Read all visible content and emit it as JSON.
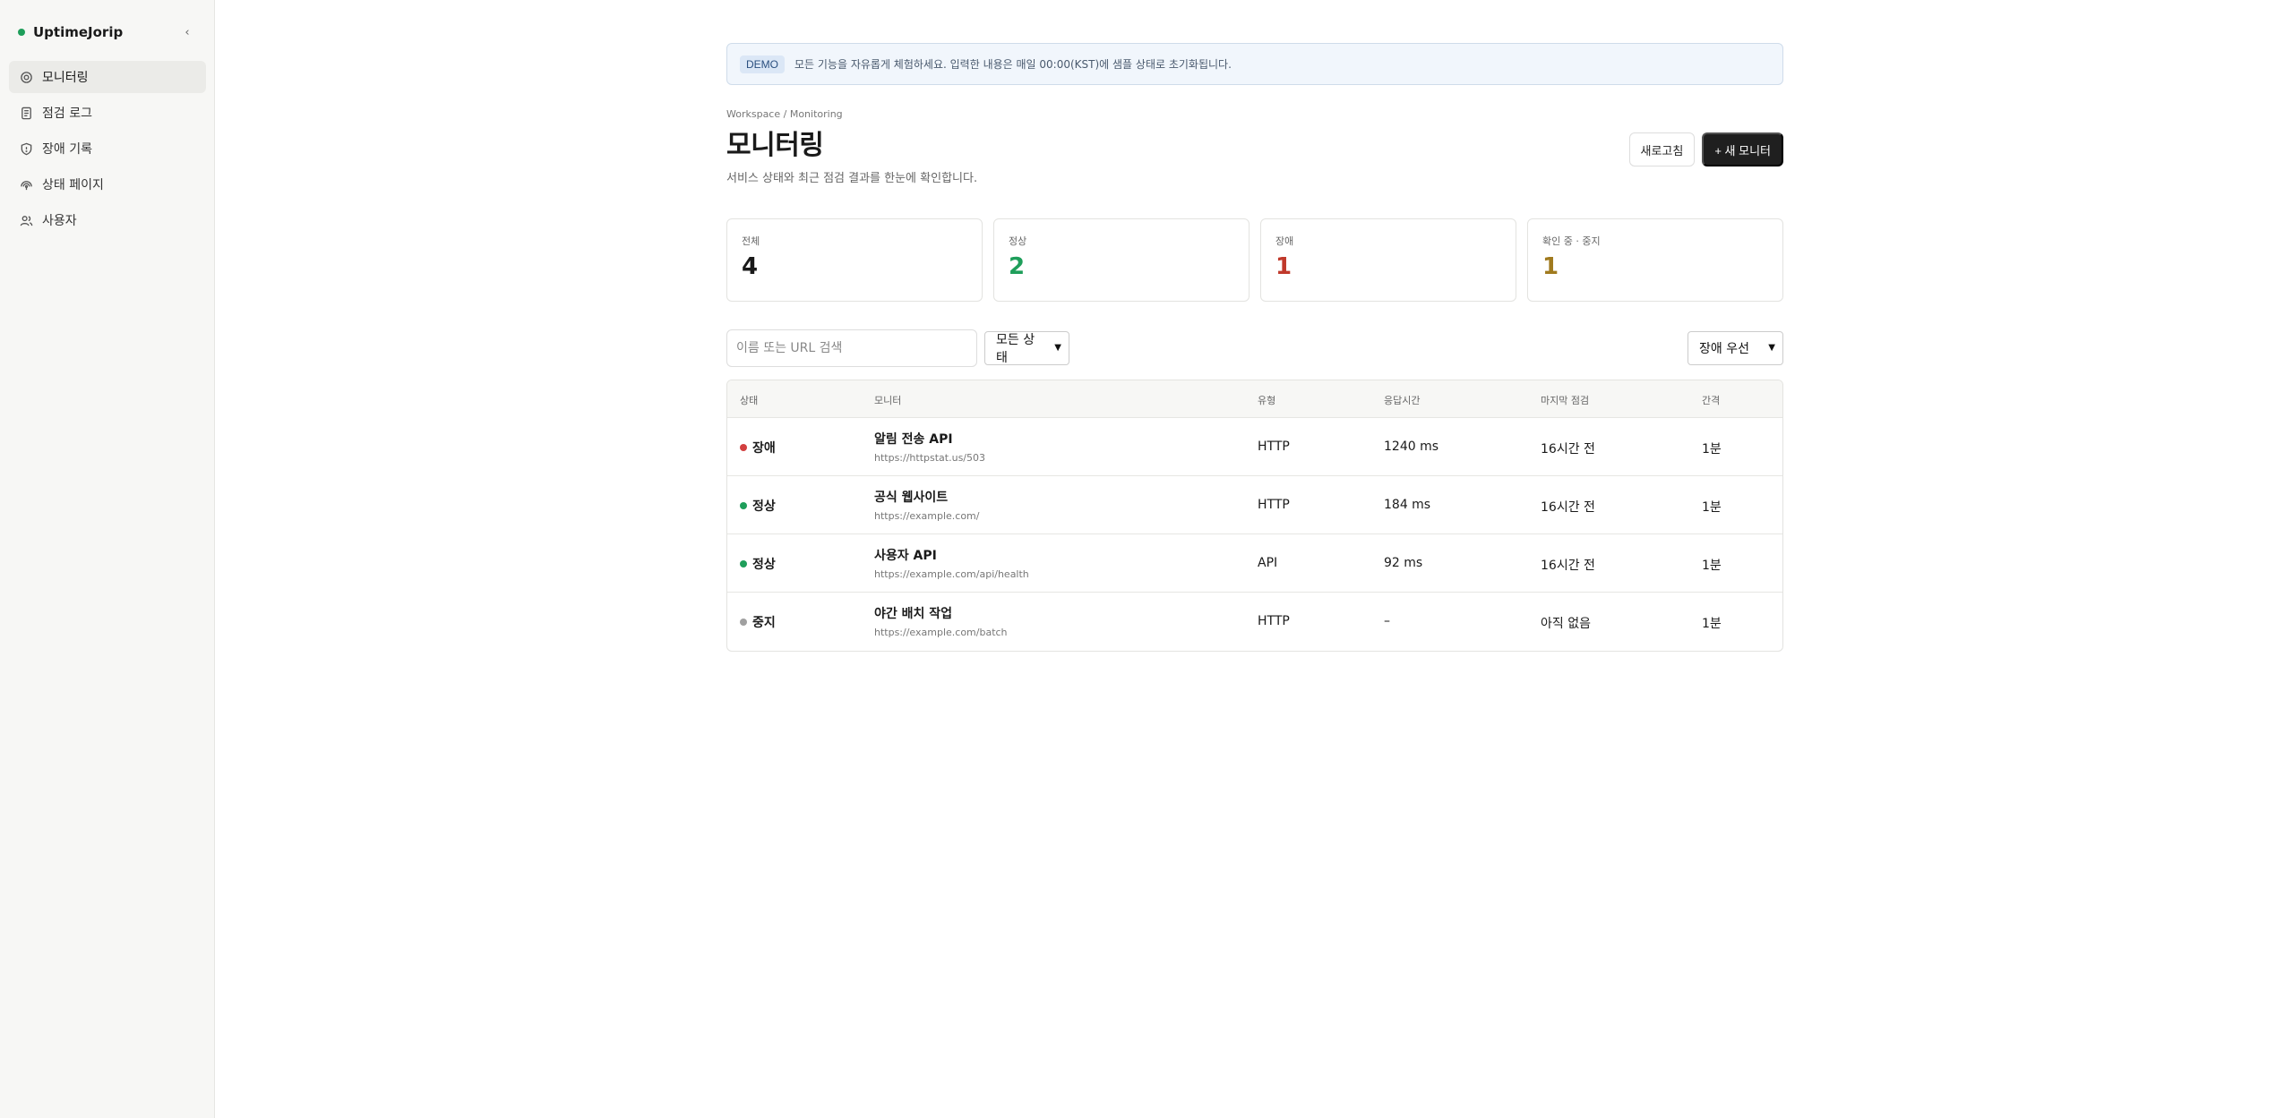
{
  "app": {
    "name": "UptimeJorip",
    "brand_color": "#1e9e5a"
  },
  "sidebar": {
    "collapse_icon": "chevron-left-icon",
    "items": [
      {
        "label": "모니터링",
        "icon": "monitor-icon",
        "active": true
      },
      {
        "label": "점검 로그",
        "icon": "document-icon",
        "active": false
      },
      {
        "label": "장애 기록",
        "icon": "shield-icon",
        "active": false
      },
      {
        "label": "상태 페이지",
        "icon": "broadcast-icon",
        "active": false
      },
      {
        "label": "사용자",
        "icon": "users-icon",
        "active": false
      }
    ]
  },
  "banner": {
    "badge": "DEMO",
    "text": "모든 기능을 자유롭게 체험하세요. 입력한 내용은 매일 00:00(KST)에 샘플 상태로 초기화됩니다."
  },
  "header": {
    "breadcrumb": "Workspace / Monitoring",
    "title": "모니터링",
    "subtitle": "서비스 상태와 최근 점검 결과를 한눈에 확인합니다.",
    "refresh_label": "새로고침",
    "new_label": "+ 새 모니터"
  },
  "stats": [
    {
      "label": "전체",
      "value": "4",
      "color": "#1a1a1a"
    },
    {
      "label": "정상",
      "value": "2",
      "color": "#1e9e5a"
    },
    {
      "label": "장애",
      "value": "1",
      "color": "#c0392b"
    },
    {
      "label": "확인 중 · 중지",
      "value": "1",
      "color": "#a07a1e"
    }
  ],
  "filters": {
    "search_placeholder": "이름 또는 URL 검색",
    "status_value": "모든 상태",
    "sort_value": "장애 우선"
  },
  "table": {
    "columns": {
      "status": "상태",
      "monitor": "모니터",
      "type": "유형",
      "response": "응답시간",
      "last_check": "마지막 점검",
      "interval": "간격"
    },
    "rows": [
      {
        "status": "장애",
        "status_color": "#d23f3f",
        "name": "알림 전송 API",
        "url": "https://httpstat.us/503",
        "type": "HTTP",
        "response": "1240 ms",
        "last_check": "16시간 전",
        "interval": "1분"
      },
      {
        "status": "정상",
        "status_color": "#1e9e5a",
        "name": "공식 웹사이트",
        "url": "https://example.com/",
        "type": "HTTP",
        "response": "184 ms",
        "last_check": "16시간 전",
        "interval": "1분"
      },
      {
        "status": "정상",
        "status_color": "#1e9e5a",
        "name": "사용자 API",
        "url": "https://example.com/api/health",
        "type": "API",
        "response": "92 ms",
        "last_check": "16시간 전",
        "interval": "1분"
      },
      {
        "status": "중지",
        "status_color": "#a0a0a0",
        "name": "야간 배치 작업",
        "url": "https://example.com/batch",
        "type": "HTTP",
        "response": "–",
        "last_check": "아직 없음",
        "interval": "1분"
      }
    ]
  }
}
